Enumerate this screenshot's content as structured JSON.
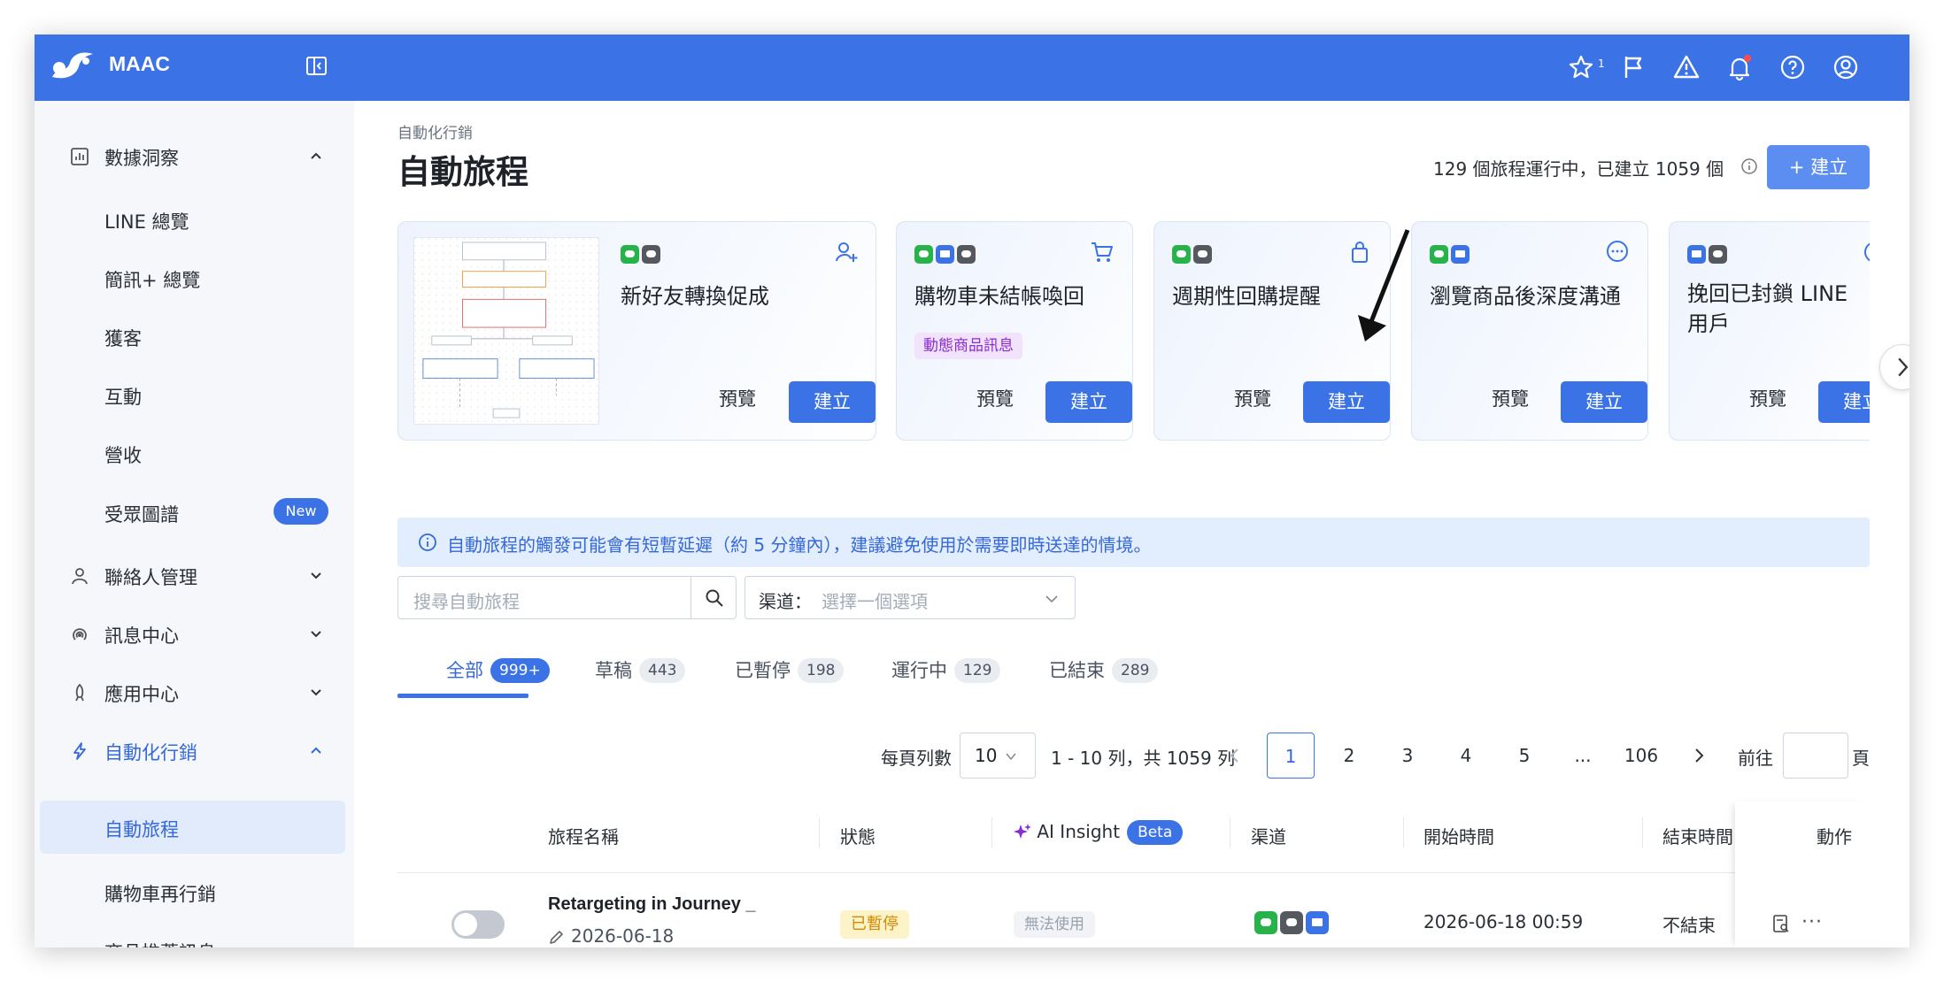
{
  "app": {
    "brand": "MAAC",
    "accent": "#3b73e6"
  },
  "topbar": {
    "icons": [
      "star-icon",
      "flag-icon",
      "warning-icon",
      "bell-icon",
      "help-icon",
      "user-icon"
    ],
    "star_count": "1"
  },
  "sidebar": {
    "items": [
      {
        "label": "數據洞察",
        "icon": "chart-icon",
        "expanded": true
      },
      {
        "label": "LINE 總覽"
      },
      {
        "label": "簡訊+ 總覽"
      },
      {
        "label": "獲客"
      },
      {
        "label": "互動"
      },
      {
        "label": "營收"
      },
      {
        "label": "受眾圖譜",
        "badge": "New"
      },
      {
        "label": "聯絡人管理",
        "icon": "user-icon"
      },
      {
        "label": "訊息中心",
        "icon": "broadcast-icon"
      },
      {
        "label": "應用中心",
        "icon": "rocket-icon"
      },
      {
        "label": "自動化行銷",
        "icon": "bolt-icon",
        "expanded": true
      },
      {
        "label": "自動旅程",
        "selected": true
      },
      {
        "label": "購物車再行銷"
      },
      {
        "label": "商品推薦訊息"
      }
    ]
  },
  "page": {
    "breadcrumb": "自動化行銷",
    "title": "自動旅程",
    "summary": "129 個旅程運行中，已建立 1059 個",
    "create_label": "+ 建立"
  },
  "templates": [
    {
      "name": "新好友轉換促成",
      "channels": [
        "line",
        "sms"
      ],
      "icon": "user-add-icon",
      "preview": "預覽",
      "create": "建立"
    },
    {
      "name": "購物車未結帳喚回",
      "channels": [
        "line",
        "mail",
        "sms"
      ],
      "icon": "cart-icon",
      "tag": "動態商品訊息",
      "preview": "預覽",
      "create": "建立"
    },
    {
      "name": "週期性回購提醒",
      "channels": [
        "line",
        "sms"
      ],
      "icon": "bag-icon",
      "preview": "預覽",
      "create": "建立"
    },
    {
      "name": "瀏覽商品後深度溝通",
      "channels": [
        "line",
        "mail"
      ],
      "icon": "chat-icon",
      "preview": "預覽",
      "create": "建立"
    },
    {
      "name": "挽回已封鎖 LINE 用戶",
      "channels": [
        "mail",
        "sms"
      ],
      "icon": "clock-icon",
      "preview": "預覽",
      "create": "建立"
    }
  ],
  "banner": {
    "text": "自動旅程的觸發可能會有短暫延遲（約 5 分鐘內），建議避免使用於需要即時送達的情境。"
  },
  "filters": {
    "search_placeholder": "搜尋自動旅程",
    "channel_label": "渠道：",
    "channel_placeholder": "選擇一個選項"
  },
  "tabs": [
    {
      "label": "全部",
      "count": "999+",
      "active": true
    },
    {
      "label": "草稿",
      "count": "443"
    },
    {
      "label": "已暫停",
      "count": "198"
    },
    {
      "label": "運行中",
      "count": "129"
    },
    {
      "label": "已結束",
      "count": "289"
    }
  ],
  "pagination": {
    "per_page_label": "每頁列數",
    "per_page": "10",
    "range_text": "1 - 10 列，共 1059 列",
    "pages": [
      "1",
      "2",
      "3",
      "4",
      "5",
      "...",
      "106"
    ],
    "current": "1",
    "goto_label": "前往",
    "page_suffix": "頁"
  },
  "table": {
    "headers": {
      "name": "旅程名稱",
      "status": "狀態",
      "ai": "AI Insight",
      "ai_badge": "Beta",
      "channel": "渠道",
      "start": "開始時間",
      "end": "結束時間",
      "action": "動作"
    },
    "rows": [
      {
        "enabled": false,
        "name": "Retargeting in Journey _",
        "date": "2026-06-18",
        "status": "已暫停",
        "ai_insight": "無法使用",
        "channels": [
          "line",
          "sms",
          "mail"
        ],
        "start": "2026-06-18 00:59",
        "end": "不結束"
      }
    ]
  }
}
